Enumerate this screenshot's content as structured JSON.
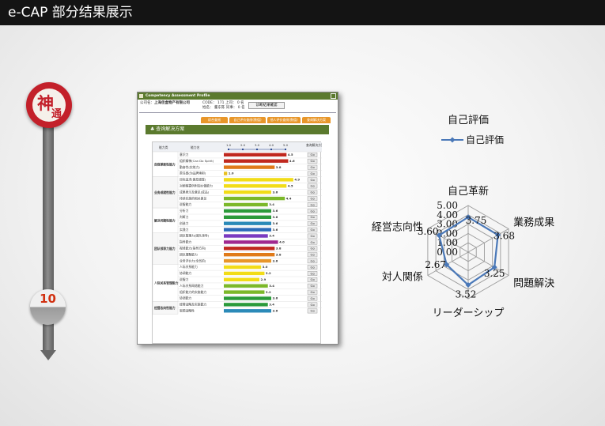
{
  "page": {
    "title": "e-CAP 部分结果展示"
  },
  "logo": {
    "char1": "神",
    "char2": "通"
  },
  "step": {
    "number": "10"
  },
  "report": {
    "header": "Competency Assessment Profile",
    "company_label": "公司名：",
    "company": "上海佳盒物产有限公司",
    "code_line": "CODE： 171   上司： 0 名",
    "name_line": "姓名：   董东陈   同事： 0 名",
    "diagnose_button": "诊断結果確認",
    "tabs": [
      "综合查阅",
      "自己评价查阅(数值)",
      "他人评价查阅(数值)",
      "查询解决方案"
    ],
    "section_title": "♣ 查询解决方案",
    "col_category": "能力类",
    "col_ability": "能力名",
    "col_solution": "查询解决方案",
    "scale_labels": [
      "1.0",
      "2.0",
      "3.0",
      "4.0",
      "5.0"
    ],
    "groups": [
      {
        "name": "自我革新性能力",
        "rows": [
          {
            "name": "意识力",
            "score": 4.5,
            "color": "#c0281e"
          },
          {
            "name": "组织精神(Can Do Spirit)",
            "score": 4.6,
            "color": "#c0281e"
          },
          {
            "name": "勤奋性(实效力)",
            "score": 3.8,
            "color": "#e07a1a"
          },
          {
            "name": "责任感(为品牌承担)",
            "score": 1.0,
            "color": "#e8c020"
          }
        ]
      },
      {
        "name": "业务成就性能力",
        "rows": [
          {
            "name": "目标追求(意愿感受)",
            "score": 4.9,
            "color": "#f2dc18"
          },
          {
            "name": "对顾客提供附加价值能力",
            "score": 4.5,
            "color": "#f2dc18"
          },
          {
            "name": "成果表示及意见(成品)",
            "score": 3.6,
            "color": "#f2dc18"
          },
          {
            "name": "持续实施的相关意见",
            "score": 4.4,
            "color": "#7cb82a"
          },
          {
            "name": "说服能力",
            "score": 3.4,
            "color": "#7cb82a"
          }
        ]
      },
      {
        "name": "解决问题性能力",
        "rows": [
          {
            "name": "分析力",
            "score": 3.6,
            "color": "#2a9a3a"
          },
          {
            "name": "判断力",
            "score": 3.6,
            "color": "#2a9a3a"
          },
          {
            "name": "创造力",
            "score": 3.6,
            "color": "#2b8ab8"
          },
          {
            "name": "实践力",
            "score": 3.6,
            "color": "#2b6ab8"
          }
        ]
      },
      {
        "name": "团队领导力能力",
        "rows": [
          {
            "name": "团队管理力(团队领导)",
            "score": 3.4,
            "color": "#7a3ac0"
          },
          {
            "name": "指导能力",
            "score": 4.0,
            "color": "#a02890"
          },
          {
            "name": "视线能力(指导方向)",
            "score": 3.8,
            "color": "#c0281e"
          },
          {
            "name": "团队凝聚能力",
            "score": 3.8,
            "color": "#e07a1a"
          },
          {
            "name": "业务评价力(全员的)",
            "score": 3.6,
            "color": "#e8962a"
          }
        ]
      },
      {
        "name": "人际关系管理能力",
        "rows": [
          {
            "name": "人际关系能力",
            "score": 3.0,
            "color": "#f2dc18"
          },
          {
            "name": "协调能力",
            "score": 3.2,
            "color": "#f2dc18"
          },
          {
            "name": "说服力",
            "score": 2.9,
            "color": "#f2dc18"
          },
          {
            "name": "人际关系网络能力",
            "score": 3.4,
            "color": "#7cb82a"
          },
          {
            "name": "组织能力的实施能力",
            "score": 3.2,
            "color": "#7cb82a"
          },
          {
            "name": "协调能力",
            "score": 3.6,
            "color": "#2a9a3a"
          }
        ]
      },
      {
        "name": "经营志向性能力",
        "rows": [
          {
            "name": "经营战略及实施能力",
            "score": 3.4,
            "color": "#2a9a3a"
          },
          {
            "name": "思想战略性",
            "score": 3.6,
            "color": "#2b8ab8"
          }
        ]
      }
    ],
    "solution_button": "Go"
  },
  "chart_data": {
    "type": "radar",
    "title": "自己評価",
    "legend": [
      "自己評価"
    ],
    "legend_position": "top",
    "categories": [
      "自己革新",
      "業務成果",
      "問題解決",
      "リーダーシップ",
      "対人関係",
      "経営志向性"
    ],
    "axis_ticks": [
      "0.00",
      "1.00",
      "2.00",
      "3.00",
      "4.00",
      "5.00"
    ],
    "range": [
      0,
      5
    ],
    "series": [
      {
        "name": "自己評価",
        "values": [
          3.75,
          3.68,
          3.25,
          3.52,
          2.67,
          3.6
        ],
        "labels": [
          "3.75",
          "3.68",
          "3.25",
          "3.52",
          "2.67",
          "3.60"
        ],
        "color": "#4a78b8"
      }
    ]
  }
}
